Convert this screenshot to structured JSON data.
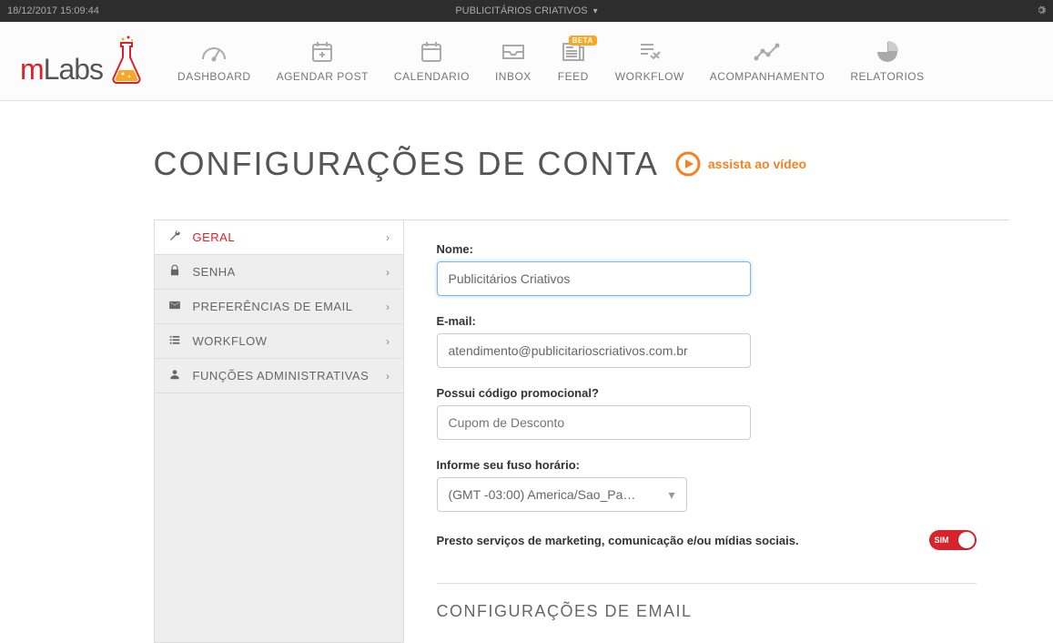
{
  "topbar": {
    "datetime": "18/12/2017 15:09:44",
    "account_selector": "PUBLICITÁRIOS CRIATIVOS"
  },
  "logo": {
    "brand_m": "m",
    "brand_labs": "Labs"
  },
  "nav": [
    {
      "label": "DASHBOARD",
      "icon": "gauge"
    },
    {
      "label": "AGENDAR POST",
      "icon": "calplus"
    },
    {
      "label": "CALENDARIO",
      "icon": "calendar"
    },
    {
      "label": "INBOX",
      "icon": "inbox"
    },
    {
      "label": "FEED",
      "icon": "news",
      "badge": "BETA"
    },
    {
      "label": "WORKFLOW",
      "icon": "approve"
    },
    {
      "label": "ACOMPANHAMENTO",
      "icon": "line"
    },
    {
      "label": "RELATORIOS",
      "icon": "pie"
    }
  ],
  "page": {
    "title": "CONFIGURAÇÕES DE CONTA",
    "video_link": "assista ao vídeo"
  },
  "sidebar": [
    {
      "label": "GERAL",
      "icon": "wrench",
      "active": true
    },
    {
      "label": "SENHA",
      "icon": "lock",
      "active": false
    },
    {
      "label": "PREFERÊNCIAS DE EMAIL",
      "icon": "envelope",
      "active": false
    },
    {
      "label": "WORKFLOW",
      "icon": "list",
      "active": false
    },
    {
      "label": "FUNÇÕES ADMINISTRATIVAS",
      "icon": "user",
      "active": false
    }
  ],
  "form": {
    "name_label": "Nome:",
    "name_value": "Publicitários Criativos",
    "email_label": "E-mail:",
    "email_value": "atendimento@publicitarioscriativos.com.br",
    "promo_label": "Possui código promocional?",
    "promo_placeholder": "Cupom de Desconto",
    "tz_label": "Informe seu fuso horário:",
    "tz_value": "(GMT -03:00) America/Sao_Pa…",
    "marketing_statement": "Presto serviços de marketing, comunicação e/ou mídias sociais.",
    "toggle_on_label": "SIM",
    "section2_title": "CONFIGURAÇÕES DE EMAIL"
  }
}
